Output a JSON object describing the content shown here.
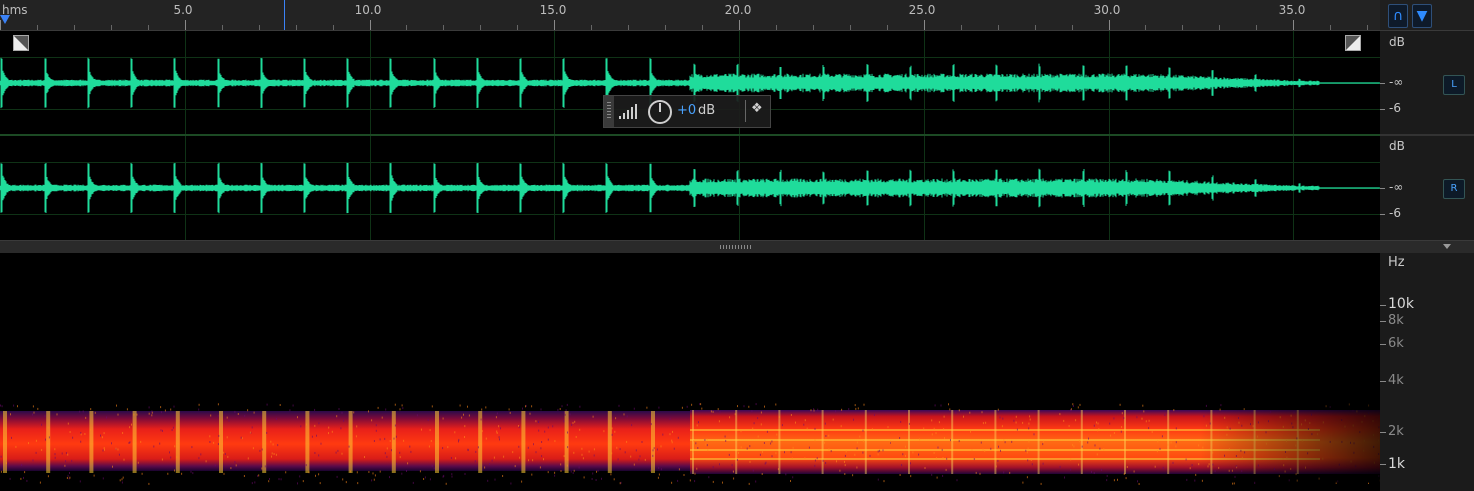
{
  "ruler": {
    "unit_label": "hms",
    "labels": [
      "5.0",
      "10.0",
      "15.0",
      "20.0",
      "25.0",
      "30.0",
      "35.0"
    ]
  },
  "toolbar": {
    "snap_icon": "magnet-icon",
    "marker_icon": "marker-icon"
  },
  "hud": {
    "value": "+0",
    "unit": "dB"
  },
  "db_scale": {
    "left": {
      "unit": "dB",
      "center": "-∞",
      "lower": "-6",
      "channel": "L"
    },
    "right": {
      "unit": "dB",
      "center": "-∞",
      "lower": "-6",
      "channel": "R"
    }
  },
  "freq_scale": {
    "unit": "Hz",
    "labels": [
      "10k",
      "8k",
      "6k",
      "4k",
      "2k",
      "1k"
    ]
  },
  "colors": {
    "waveform": "#1fdc9b",
    "accent": "#2e8bff",
    "grid": "#0f3216"
  }
}
